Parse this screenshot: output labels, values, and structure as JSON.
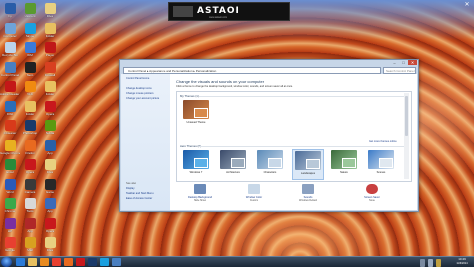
{
  "banner": {
    "title": "ASTAOI",
    "subtitle": "www.astaoi.com"
  },
  "desktop_icons": [
    {
      "label": "hp",
      "color": "#2a5da8"
    },
    {
      "label": "Computer",
      "color": "#6fa3d8"
    },
    {
      "label": "Recycle Bin",
      "color": "#bcd4ea"
    },
    {
      "label": "Control Panel",
      "color": "#4a7fc0"
    },
    {
      "label": "Adobe Reader XI",
      "color": "#c41818"
    },
    {
      "label": "IObit",
      "color": "#2c6db8"
    },
    {
      "label": "CCleaner",
      "color": "#d83a1a"
    },
    {
      "label": "Google Chrome",
      "color": "#e8b020"
    },
    {
      "label": "Excel",
      "color": "#2a8a3a"
    },
    {
      "label": "Word",
      "color": "#2a5ab8"
    },
    {
      "label": "Chrome",
      "color": "#3ba84a"
    },
    {
      "label": "HP",
      "color": "#7a2fa0"
    },
    {
      "label": "Google",
      "color": "#e84030"
    },
    {
      "label": "Utorrent",
      "color": "#5a9a30"
    },
    {
      "label": "Skype",
      "color": "#1aa0e0"
    },
    {
      "label": "IDM",
      "color": "#3a7ad8"
    },
    {
      "label": "Nero",
      "color": "#222222"
    },
    {
      "label": "VLC",
      "color": "#f08a10"
    },
    {
      "label": "Folder",
      "color": "#e8c060"
    },
    {
      "label": "Photoshop",
      "color": "#1a3a6a"
    },
    {
      "label": "Firefox",
      "color": "#e86a20"
    },
    {
      "label": "Opera",
      "color": "#c8181c"
    },
    {
      "label": "Camera",
      "color": "#3a3a3a"
    },
    {
      "label": "Tools",
      "color": "#d8d8d8"
    },
    {
      "label": "App",
      "color": "#b02828"
    },
    {
      "label": "Mail",
      "color": "#d8a020"
    },
    {
      "label": "Files",
      "color": "#e8d080"
    },
    {
      "label": "Folder",
      "color": "#e8c060"
    },
    {
      "label": "Player",
      "color": "#c01818"
    },
    {
      "label": "Firewall",
      "color": "#d84020"
    },
    {
      "label": "Folder",
      "color": "#e8c060"
    },
    {
      "label": "Opera",
      "color": "#c8181c"
    },
    {
      "label": "Nvidia",
      "color": "#5a9a10"
    },
    {
      "label": "App",
      "color": "#2860a8"
    },
    {
      "label": "Files",
      "color": "#e8d080"
    },
    {
      "label": "Game",
      "color": "#282828"
    },
    {
      "label": "App",
      "color": "#3a6ab8"
    },
    {
      "label": "Opera",
      "color": "#c8181c"
    },
    {
      "label": "Files",
      "color": "#e8d080"
    }
  ],
  "window": {
    "breadcrumb": "Control Panel  ▸  Appearance and Personalization  ▸  Personalization",
    "search_placeholder": "Search Control Panel",
    "minimize": "–",
    "maximize": "□",
    "close": "✕",
    "left_links": [
      "Control Panel Home",
      "Change desktop icons",
      "Change mouse pointers",
      "Change your account picture"
    ],
    "see_also_heading": "See also",
    "see_also_links": [
      "Display",
      "Taskbar and Start Menu",
      "Ease of Access Center"
    ],
    "heading": "Change the visuals and sounds on your computer",
    "subtext": "Click a theme to change the desktop background, window color, sounds, and screen saver all at once.",
    "my_themes_heading": "My Themes (1)",
    "my_themes": [
      {
        "label": "Unsaved Theme",
        "colors": [
          "#8a4a2a",
          "#d88a4a"
        ]
      }
    ],
    "online_link": "Get more themes online",
    "aero_heading": "Aero Themes (6)",
    "aero_themes": [
      {
        "label": "Windows 7",
        "colors": [
          "#1a5aa8",
          "#5ab0e8"
        ]
      },
      {
        "label": "Architecture",
        "colors": [
          "#3a4a6a",
          "#9aaabb"
        ]
      },
      {
        "label": "Characters",
        "colors": [
          "#5a8ab8",
          "#c8d8e8"
        ]
      },
      {
        "label": "Landscapes",
        "colors": [
          "#4a6a98",
          "#b8c8d8"
        ]
      },
      {
        "label": "Nature",
        "colors": [
          "#3a6a3a",
          "#9ac89a"
        ]
      },
      {
        "label": "Scenes",
        "colors": [
          "#3a7ac8",
          "#e0e8f0"
        ]
      }
    ],
    "bottom_options": [
      {
        "title": "Desktop Background",
        "value": "Slide Show"
      },
      {
        "title": "Window Color",
        "value": "Custom"
      },
      {
        "title": "Sounds",
        "value": "Windows Default"
      },
      {
        "title": "Screen Saver",
        "value": "None"
      }
    ]
  },
  "taskbar": {
    "items": [
      {
        "name": "ie",
        "color": "#2a7ad8"
      },
      {
        "name": "explorer",
        "color": "#e8c060"
      },
      {
        "name": "media-player",
        "color": "#e88a20"
      },
      {
        "name": "chrome",
        "color": "#e84030"
      },
      {
        "name": "firefox",
        "color": "#e86a20"
      },
      {
        "name": "opera",
        "color": "#c8181c"
      },
      {
        "name": "photoshop",
        "color": "#1a3a6a"
      },
      {
        "name": "skype",
        "color": "#1aa0e0"
      },
      {
        "name": "control-panel",
        "color": "#4a7fc0"
      }
    ],
    "time": "10:49",
    "date": "11/6/2014"
  }
}
